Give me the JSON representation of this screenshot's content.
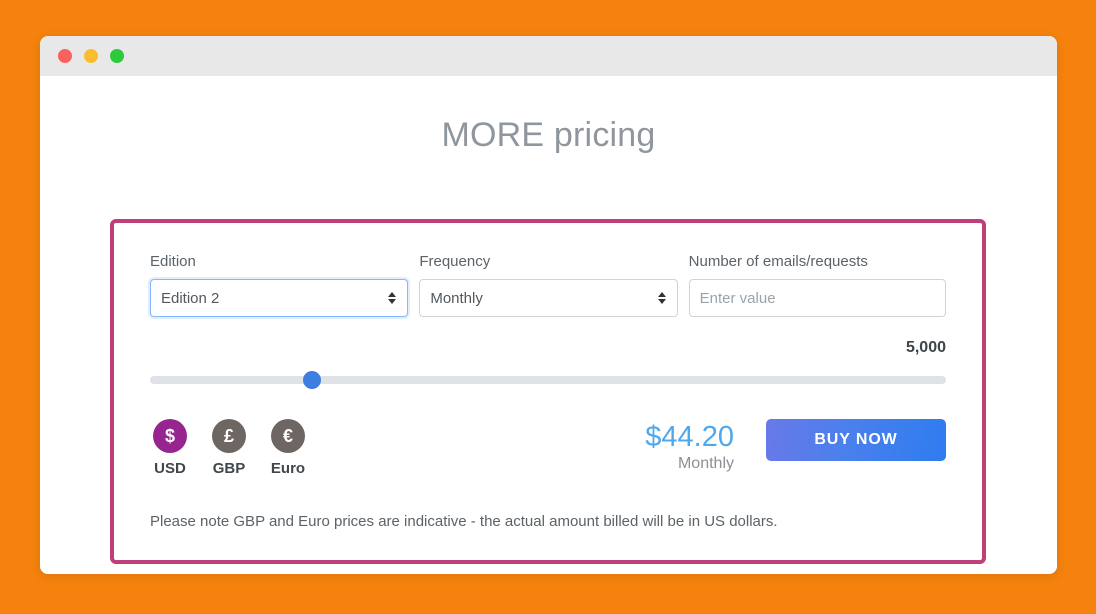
{
  "window": {
    "traffic_lights": [
      "close",
      "minimize",
      "maximize"
    ]
  },
  "page": {
    "title": "MORE pricing"
  },
  "form": {
    "edition": {
      "label": "Edition",
      "value": "Edition 2",
      "focused": true
    },
    "frequency": {
      "label": "Frequency",
      "value": "Monthly",
      "focused": false
    },
    "emails": {
      "label": "Number of emails/requests",
      "value": "",
      "placeholder": "Enter value"
    }
  },
  "slider": {
    "value_label": "5,000",
    "value": 5000,
    "percent": 20.4
  },
  "currencies": [
    {
      "code": "USD",
      "symbol": "$",
      "label": "USD",
      "active": true,
      "color": "#96258F"
    },
    {
      "code": "GBP",
      "symbol": "£",
      "label": "GBP",
      "active": false,
      "color": "#6E6662"
    },
    {
      "code": "EURO",
      "symbol": "€",
      "label": "Euro",
      "active": false,
      "color": "#6E6662"
    }
  ],
  "price": {
    "amount": "$44.20",
    "period": "Monthly"
  },
  "buy_button": {
    "label": "BUY NOW"
  },
  "note": {
    "text": "Please note GBP and Euro prices are indicative - the actual amount billed will be in US dollars."
  },
  "colors": {
    "background": "#F5820D",
    "card_border": "#BF4078",
    "accent_blue": "#3D7EE0",
    "price_blue": "#50A8EC",
    "usd_purple": "#96258F"
  }
}
